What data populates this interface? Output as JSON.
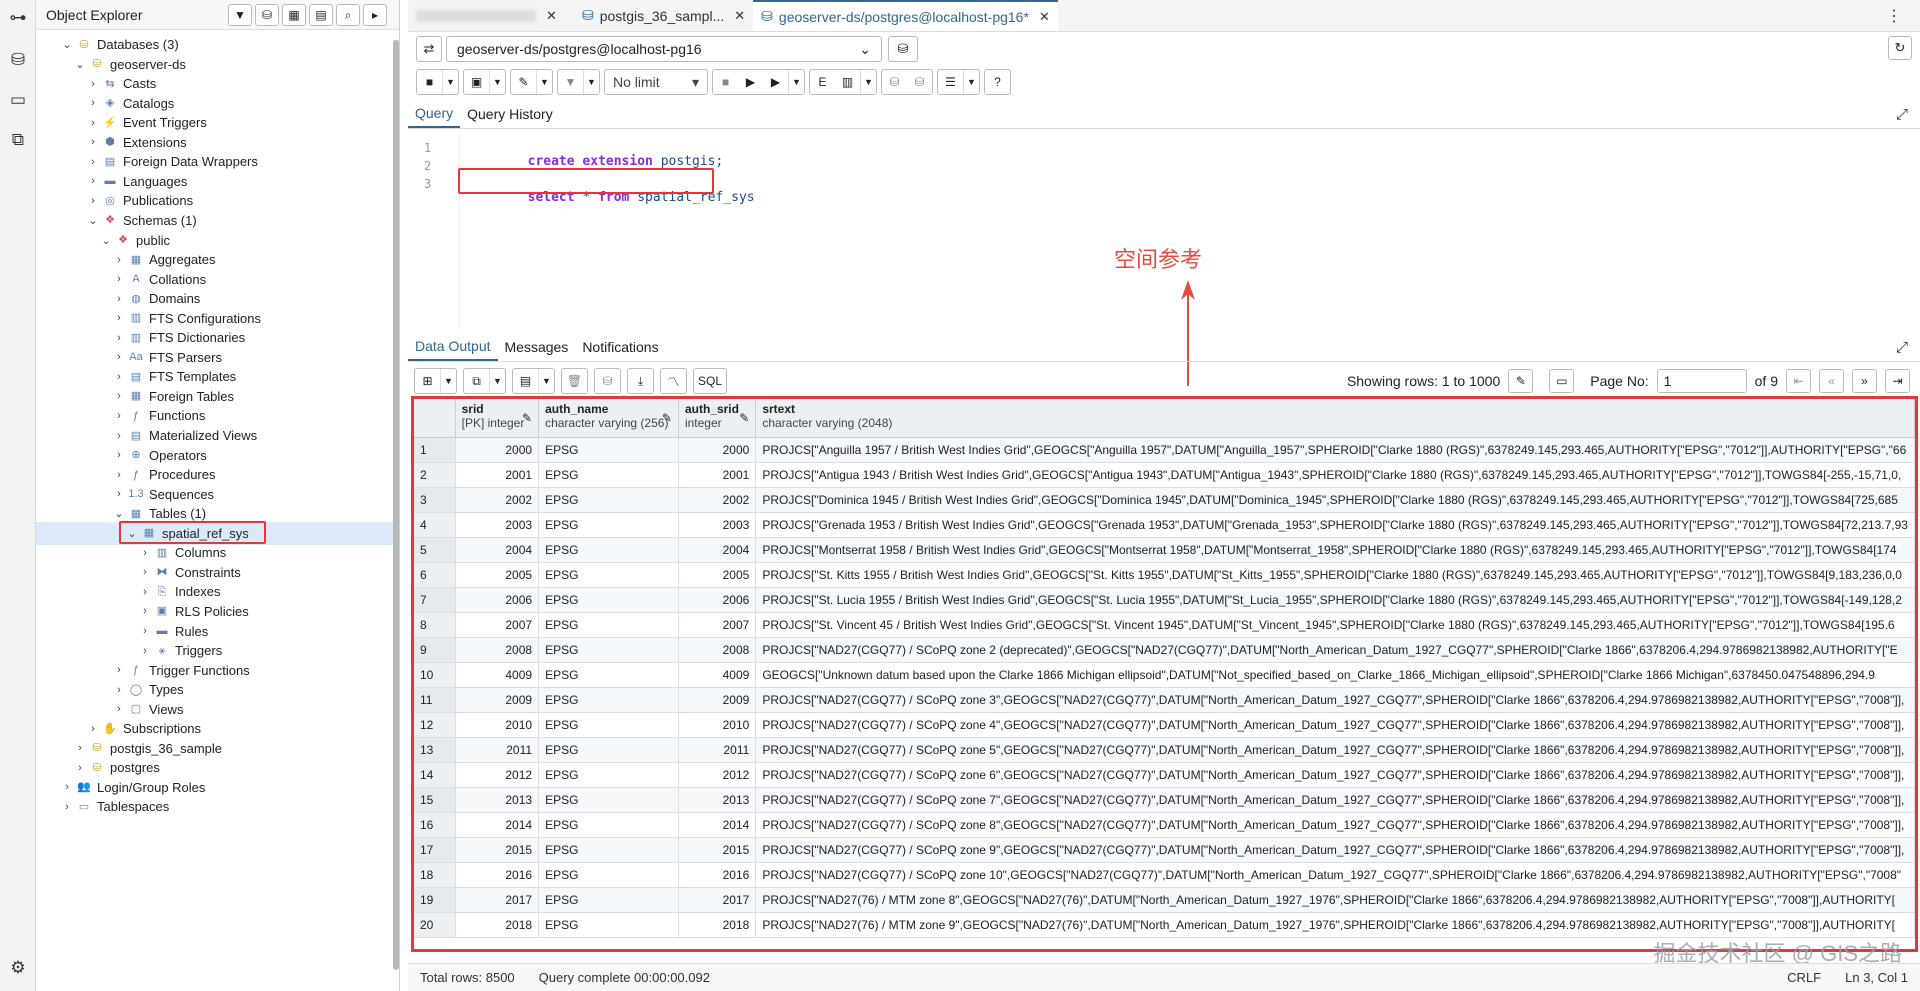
{
  "object_explorer": {
    "title": "Object Explorer",
    "tree": [
      {
        "label": "Databases (3)",
        "depth": 0,
        "state": "open",
        "icon": "database-icon"
      },
      {
        "label": "geoserver-ds",
        "depth": 1,
        "state": "open",
        "icon": "database-icon"
      },
      {
        "label": "Casts",
        "depth": 2,
        "state": "closed",
        "icon": "cast-icon"
      },
      {
        "label": "Catalogs",
        "depth": 2,
        "state": "closed",
        "icon": "catalog-icon"
      },
      {
        "label": "Event Triggers",
        "depth": 2,
        "state": "closed",
        "icon": "event-trigger-icon"
      },
      {
        "label": "Extensions",
        "depth": 2,
        "state": "closed",
        "icon": "extension-icon"
      },
      {
        "label": "Foreign Data Wrappers",
        "depth": 2,
        "state": "closed",
        "icon": "fdw-icon"
      },
      {
        "label": "Languages",
        "depth": 2,
        "state": "closed",
        "icon": "language-icon"
      },
      {
        "label": "Publications",
        "depth": 2,
        "state": "closed",
        "icon": "publication-icon"
      },
      {
        "label": "Schemas (1)",
        "depth": 2,
        "state": "open",
        "icon": "schema-icon"
      },
      {
        "label": "public",
        "depth": 3,
        "state": "open",
        "icon": "schema-icon"
      },
      {
        "label": "Aggregates",
        "depth": 4,
        "state": "closed",
        "icon": "aggregate-icon"
      },
      {
        "label": "Collations",
        "depth": 4,
        "state": "closed",
        "icon": "collation-icon"
      },
      {
        "label": "Domains",
        "depth": 4,
        "state": "closed",
        "icon": "domain-icon"
      },
      {
        "label": "FTS Configurations",
        "depth": 4,
        "state": "closed",
        "icon": "fts-config-icon"
      },
      {
        "label": "FTS Dictionaries",
        "depth": 4,
        "state": "closed",
        "icon": "fts-dictionary-icon"
      },
      {
        "label": "FTS Parsers",
        "depth": 4,
        "state": "closed",
        "icon": "fts-parser-icon"
      },
      {
        "label": "FTS Templates",
        "depth": 4,
        "state": "closed",
        "icon": "fts-template-icon"
      },
      {
        "label": "Foreign Tables",
        "depth": 4,
        "state": "closed",
        "icon": "foreign-table-icon"
      },
      {
        "label": "Functions",
        "depth": 4,
        "state": "closed",
        "icon": "function-icon"
      },
      {
        "label": "Materialized Views",
        "depth": 4,
        "state": "closed",
        "icon": "materialized-view-icon"
      },
      {
        "label": "Operators",
        "depth": 4,
        "state": "closed",
        "icon": "operator-icon"
      },
      {
        "label": "Procedures",
        "depth": 4,
        "state": "closed",
        "icon": "procedure-icon"
      },
      {
        "label": "Sequences",
        "depth": 4,
        "state": "closed",
        "icon": "sequence-icon"
      },
      {
        "label": "Tables (1)",
        "depth": 4,
        "state": "open",
        "icon": "table-icon"
      },
      {
        "label": "spatial_ref_sys",
        "depth": 5,
        "state": "open",
        "icon": "table-icon",
        "selected": true
      },
      {
        "label": "Columns",
        "depth": 6,
        "state": "closed",
        "icon": "column-icon"
      },
      {
        "label": "Constraints",
        "depth": 6,
        "state": "closed",
        "icon": "constraint-icon"
      },
      {
        "label": "Indexes",
        "depth": 6,
        "state": "closed",
        "icon": "index-icon"
      },
      {
        "label": "RLS Policies",
        "depth": 6,
        "state": "closed",
        "icon": "rls-policy-icon"
      },
      {
        "label": "Rules",
        "depth": 6,
        "state": "closed",
        "icon": "rule-icon"
      },
      {
        "label": "Triggers",
        "depth": 6,
        "state": "closed",
        "icon": "trigger-icon"
      },
      {
        "label": "Trigger Functions",
        "depth": 4,
        "state": "closed",
        "icon": "trigger-function-icon"
      },
      {
        "label": "Types",
        "depth": 4,
        "state": "closed",
        "icon": "type-icon"
      },
      {
        "label": "Views",
        "depth": 4,
        "state": "closed",
        "icon": "view-icon"
      },
      {
        "label": "Subscriptions",
        "depth": 2,
        "state": "closed",
        "icon": "subscription-icon"
      },
      {
        "label": "postgis_36_sample",
        "depth": 1,
        "state": "closed",
        "icon": "database-icon"
      },
      {
        "label": "postgres",
        "depth": 1,
        "state": "closed",
        "icon": "database-icon"
      },
      {
        "label": "Login/Group Roles",
        "depth": 0,
        "state": "closed",
        "icon": "role-icon"
      },
      {
        "label": "Tablespaces",
        "depth": 0,
        "state": "closed",
        "icon": "tablespace-icon"
      }
    ]
  },
  "tabs": [
    {
      "label": "",
      "blurred": true
    },
    {
      "label": "postgis_36_sampl..."
    },
    {
      "label": "geoserver-ds/postgres@localhost-pg16*",
      "active": true
    }
  ],
  "connection": {
    "value": "geoserver-ds/postgres@localhost-pg16"
  },
  "limit": {
    "value": "No limit"
  },
  "query_tabs": [
    "Query",
    "Query History"
  ],
  "editor": {
    "lines": [
      [
        {
          "k": "kw",
          "t": "create extension "
        },
        {
          "k": "id",
          "t": "postgis;"
        }
      ],
      [],
      [
        {
          "k": "kw",
          "t": "select "
        },
        {
          "k": "id",
          "t": "* "
        },
        {
          "k": "kw",
          "t": "from "
        },
        {
          "k": "id",
          "t": "spatial_ref_sys"
        }
      ]
    ]
  },
  "annotation": {
    "text": "空间参考",
    "color": "#e84a3f"
  },
  "data_tabs": [
    "Data Output",
    "Messages",
    "Notifications"
  ],
  "data_toolbar": {
    "sql_label": "SQL",
    "showing_rows": "Showing rows: 1 to 1000",
    "page_no_label": "Page No:",
    "page_no": "1",
    "of_pages": "of 9"
  },
  "grid": {
    "columns": [
      {
        "name": "srid",
        "type": "[PK] integer"
      },
      {
        "name": "auth_name",
        "type": "character varying (256)"
      },
      {
        "name": "auth_srid",
        "type": "integer"
      },
      {
        "name": "srtext",
        "type": "character varying (2048)"
      }
    ],
    "rows": [
      [
        "1",
        "2000",
        "EPSG",
        "2000",
        "PROJCS[\"Anguilla 1957 / British West Indies Grid\",GEOGCS[\"Anguilla 1957\",DATUM[\"Anguilla_1957\",SPHEROID[\"Clarke 1880 (RGS)\",6378249.145,293.465,AUTHORITY[\"EPSG\",\"7012\"]],AUTHORITY[\"EPSG\",\"66"
      ],
      [
        "2",
        "2001",
        "EPSG",
        "2001",
        "PROJCS[\"Antigua 1943 / British West Indies Grid\",GEOGCS[\"Antigua 1943\",DATUM[\"Antigua_1943\",SPHEROID[\"Clarke 1880 (RGS)\",6378249.145,293.465,AUTHORITY[\"EPSG\",\"7012\"]],TOWGS84[-255,-15,71,0,"
      ],
      [
        "3",
        "2002",
        "EPSG",
        "2002",
        "PROJCS[\"Dominica 1945 / British West Indies Grid\",GEOGCS[\"Dominica 1945\",DATUM[\"Dominica_1945\",SPHEROID[\"Clarke 1880 (RGS)\",6378249.145,293.465,AUTHORITY[\"EPSG\",\"7012\"]],TOWGS84[725,685"
      ],
      [
        "4",
        "2003",
        "EPSG",
        "2003",
        "PROJCS[\"Grenada 1953 / British West Indies Grid\",GEOGCS[\"Grenada 1953\",DATUM[\"Grenada_1953\",SPHEROID[\"Clarke 1880 (RGS)\",6378249.145,293.465,AUTHORITY[\"EPSG\",\"7012\"]],TOWGS84[72,213.7,93"
      ],
      [
        "5",
        "2004",
        "EPSG",
        "2004",
        "PROJCS[\"Montserrat 1958 / British West Indies Grid\",GEOGCS[\"Montserrat 1958\",DATUM[\"Montserrat_1958\",SPHEROID[\"Clarke 1880 (RGS)\",6378249.145,293.465,AUTHORITY[\"EPSG\",\"7012\"]],TOWGS84[174"
      ],
      [
        "6",
        "2005",
        "EPSG",
        "2005",
        "PROJCS[\"St. Kitts 1955 / British West Indies Grid\",GEOGCS[\"St. Kitts 1955\",DATUM[\"St_Kitts_1955\",SPHEROID[\"Clarke 1880 (RGS)\",6378249.145,293.465,AUTHORITY[\"EPSG\",\"7012\"]],TOWGS84[9,183,236,0,0"
      ],
      [
        "7",
        "2006",
        "EPSG",
        "2006",
        "PROJCS[\"St. Lucia 1955 / British West Indies Grid\",GEOGCS[\"St. Lucia 1955\",DATUM[\"St_Lucia_1955\",SPHEROID[\"Clarke 1880 (RGS)\",6378249.145,293.465,AUTHORITY[\"EPSG\",\"7012\"]],TOWGS84[-149,128,2"
      ],
      [
        "8",
        "2007",
        "EPSG",
        "2007",
        "PROJCS[\"St. Vincent 45 / British West Indies Grid\",GEOGCS[\"St. Vincent 1945\",DATUM[\"St_Vincent_1945\",SPHEROID[\"Clarke 1880 (RGS)\",6378249.145,293.465,AUTHORITY[\"EPSG\",\"7012\"]],TOWGS84[195.6"
      ],
      [
        "9",
        "2008",
        "EPSG",
        "2008",
        "PROJCS[\"NAD27(CGQ77) / SCoPQ zone 2 (deprecated)\",GEOGCS[\"NAD27(CGQ77)\",DATUM[\"North_American_Datum_1927_CGQ77\",SPHEROID[\"Clarke 1866\",6378206.4,294.9786982138982,AUTHORITY[\"E"
      ],
      [
        "10",
        "4009",
        "EPSG",
        "4009",
        "GEOGCS[\"Unknown datum based upon the Clarke 1866 Michigan ellipsoid\",DATUM[\"Not_specified_based_on_Clarke_1866_Michigan_ellipsoid\",SPHEROID[\"Clarke 1866 Michigan\",6378450.047548896,294.9"
      ],
      [
        "11",
        "2009",
        "EPSG",
        "2009",
        "PROJCS[\"NAD27(CGQ77) / SCoPQ zone 3\",GEOGCS[\"NAD27(CGQ77)\",DATUM[\"North_American_Datum_1927_CGQ77\",SPHEROID[\"Clarke 1866\",6378206.4,294.9786982138982,AUTHORITY[\"EPSG\",\"7008\"]],"
      ],
      [
        "12",
        "2010",
        "EPSG",
        "2010",
        "PROJCS[\"NAD27(CGQ77) / SCoPQ zone 4\",GEOGCS[\"NAD27(CGQ77)\",DATUM[\"North_American_Datum_1927_CGQ77\",SPHEROID[\"Clarke 1866\",6378206.4,294.9786982138982,AUTHORITY[\"EPSG\",\"7008\"]],"
      ],
      [
        "13",
        "2011",
        "EPSG",
        "2011",
        "PROJCS[\"NAD27(CGQ77) / SCoPQ zone 5\",GEOGCS[\"NAD27(CGQ77)\",DATUM[\"North_American_Datum_1927_CGQ77\",SPHEROID[\"Clarke 1866\",6378206.4,294.9786982138982,AUTHORITY[\"EPSG\",\"7008\"]],"
      ],
      [
        "14",
        "2012",
        "EPSG",
        "2012",
        "PROJCS[\"NAD27(CGQ77) / SCoPQ zone 6\",GEOGCS[\"NAD27(CGQ77)\",DATUM[\"North_American_Datum_1927_CGQ77\",SPHEROID[\"Clarke 1866\",6378206.4,294.9786982138982,AUTHORITY[\"EPSG\",\"7008\"]],"
      ],
      [
        "15",
        "2013",
        "EPSG",
        "2013",
        "PROJCS[\"NAD27(CGQ77) / SCoPQ zone 7\",GEOGCS[\"NAD27(CGQ77)\",DATUM[\"North_American_Datum_1927_CGQ77\",SPHEROID[\"Clarke 1866\",6378206.4,294.9786982138982,AUTHORITY[\"EPSG\",\"7008\"]],"
      ],
      [
        "16",
        "2014",
        "EPSG",
        "2014",
        "PROJCS[\"NAD27(CGQ77) / SCoPQ zone 8\",GEOGCS[\"NAD27(CGQ77)\",DATUM[\"North_American_Datum_1927_CGQ77\",SPHEROID[\"Clarke 1866\",6378206.4,294.9786982138982,AUTHORITY[\"EPSG\",\"7008\"]],"
      ],
      [
        "17",
        "2015",
        "EPSG",
        "2015",
        "PROJCS[\"NAD27(CGQ77) / SCoPQ zone 9\",GEOGCS[\"NAD27(CGQ77)\",DATUM[\"North_American_Datum_1927_CGQ77\",SPHEROID[\"Clarke 1866\",6378206.4,294.9786982138982,AUTHORITY[\"EPSG\",\"7008\"]],"
      ],
      [
        "18",
        "2016",
        "EPSG",
        "2016",
        "PROJCS[\"NAD27(CGQ77) / SCoPQ zone 10\",GEOGCS[\"NAD27(CGQ77)\",DATUM[\"North_American_Datum_1927_CGQ77\",SPHEROID[\"Clarke 1866\",6378206.4,294.9786982138982,AUTHORITY[\"EPSG\",\"7008\""
      ],
      [
        "19",
        "2017",
        "EPSG",
        "2017",
        "PROJCS[\"NAD27(76) / MTM zone 8\",GEOGCS[\"NAD27(76)\",DATUM[\"North_American_Datum_1927_1976\",SPHEROID[\"Clarke 1866\",6378206.4,294.9786982138982,AUTHORITY[\"EPSG\",\"7008\"]],AUTHORITY["
      ],
      [
        "20",
        "2018",
        "EPSG",
        "2018",
        "PROJCS[\"NAD27(76) / MTM zone 9\",GEOGCS[\"NAD27(76)\",DATUM[\"North_American_Datum_1927_1976\",SPHEROID[\"Clarke 1866\",6378206.4,294.9786982138982,AUTHORITY[\"EPSG\",\"7008\"]],AUTHORITY["
      ]
    ]
  },
  "status": {
    "total_rows": "Total rows: 8500",
    "query_complete": "Query complete 00:00:00.092",
    "eol": "CRLF",
    "cursor": "Ln 3, Col 1"
  },
  "watermark": "掘金技术社区 @ GIS之路"
}
